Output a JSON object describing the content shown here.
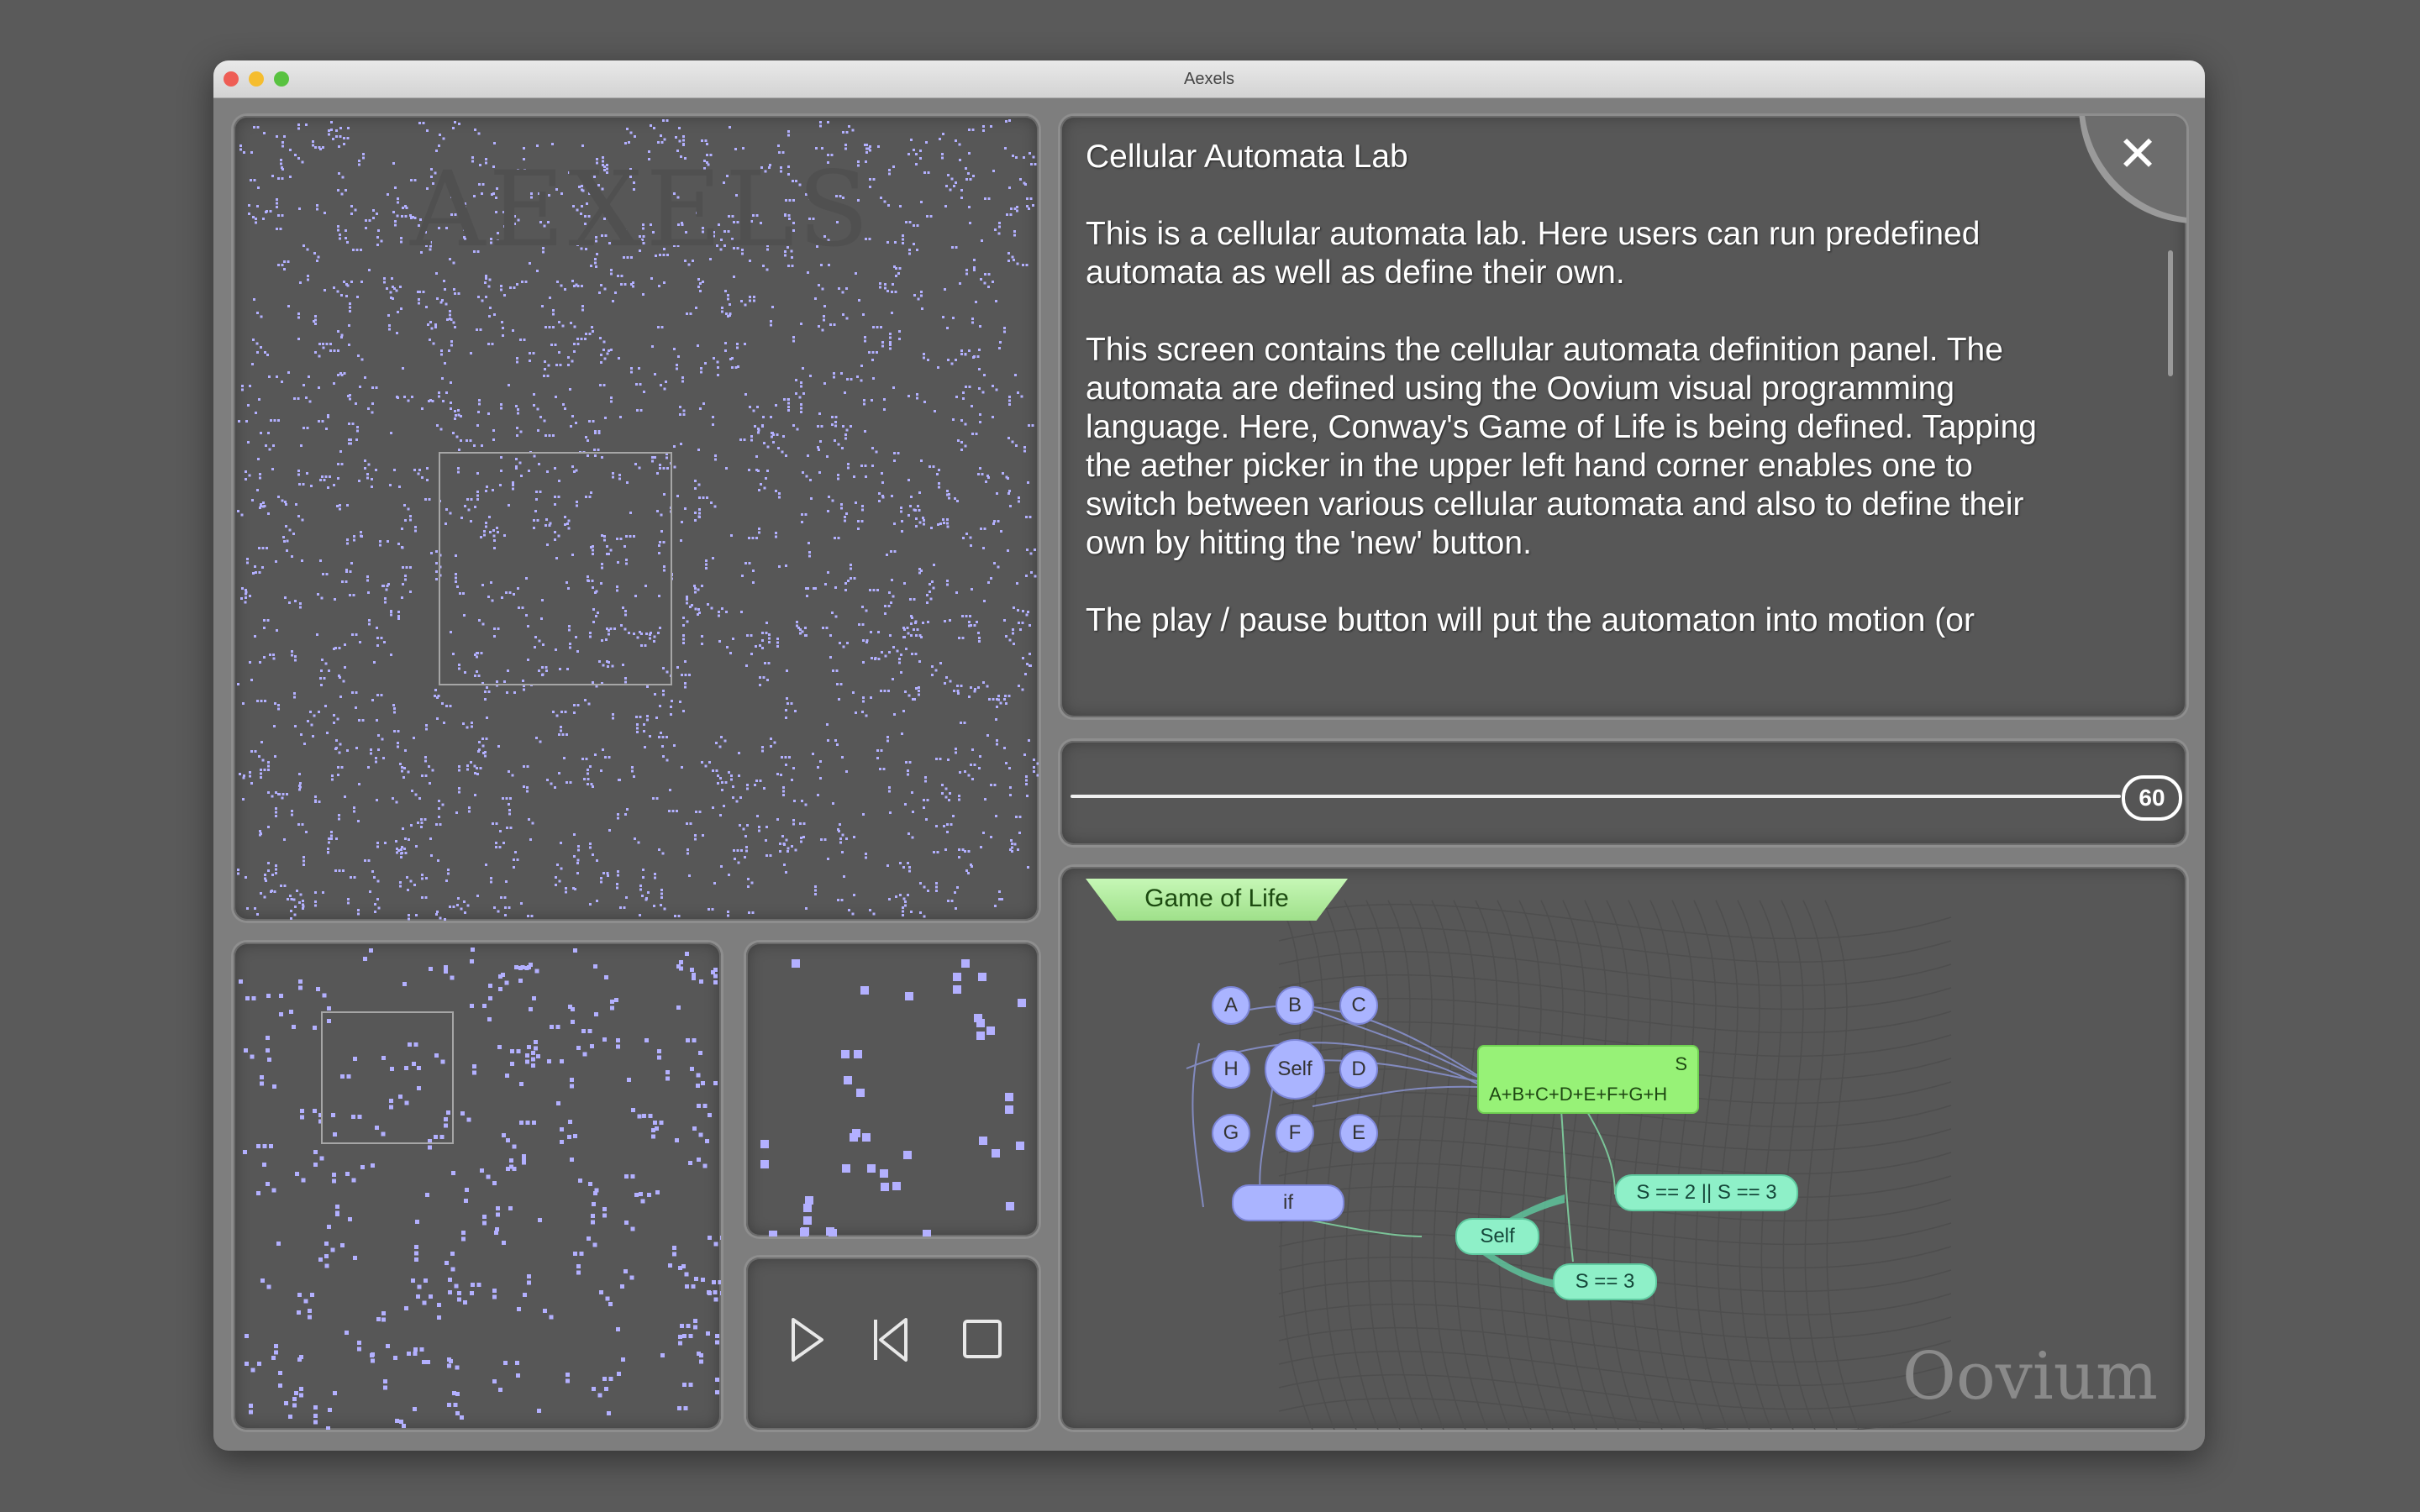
{
  "window": {
    "title": "Aexels"
  },
  "overview": {
    "watermark": "AEXELS"
  },
  "help": {
    "title": "Cellular Automata Lab",
    "paragraphs": [
      "This is a cellular automata lab.  Here users can run predefined\nautomata as well as define their own.",
      "This screen contains the cellular automata definition panel.  The\nautomata are defined using the Oovium visual programming\nlanguage.  Here, Conway's Game of Life is being defined.  Tapping\nthe aether picker in the upper left hand corner enables one to\nswitch between various cellular automata and also to define their\nown by hitting the 'new' button.",
      "The play / pause button will put the automaton into motion (or"
    ],
    "close_label": "✕"
  },
  "speed": {
    "value": "60"
  },
  "controls": {
    "play": "▷",
    "reset": "⏮",
    "stop": "□"
  },
  "editor": {
    "automaton_name": "Game of Life",
    "neighbors": [
      "A",
      "B",
      "C",
      "H",
      "Self",
      "D",
      "G",
      "F",
      "E"
    ],
    "if_label": "if",
    "sum": {
      "name": "S",
      "expression": "A+B+C+D+E+F+G+H"
    },
    "conditions": {
      "survive": "S == 2 || S == 3",
      "birth": "S == 3",
      "self": "Self"
    },
    "watermark": "Oovium"
  },
  "colors": {
    "cell": "#b3b0ff",
    "sum_box": "#97f277",
    "condition": "#8ef0c8",
    "neighbor": "#aab4ff"
  }
}
